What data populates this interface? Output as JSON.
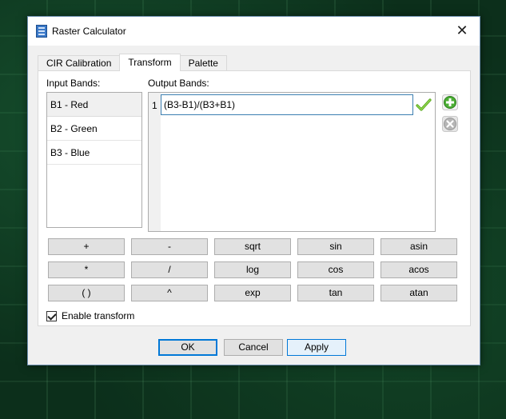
{
  "window": {
    "title": "Raster Calculator"
  },
  "tabs": [
    {
      "label": "CIR Calibration",
      "active": false
    },
    {
      "label": "Transform",
      "active": true
    },
    {
      "label": "Palette",
      "active": false
    }
  ],
  "input_bands": {
    "label": "Input Bands:",
    "items": [
      "B1 - Red",
      "B2 - Green",
      "B3 - Blue"
    ],
    "selected": "B1 - Red"
  },
  "output_bands": {
    "label": "Output Bands:",
    "rows": [
      {
        "number": "1",
        "expression": "(B3-B1)/(B3+B1)"
      }
    ]
  },
  "calc_buttons": [
    [
      "+",
      "-",
      "sqrt",
      "sin",
      "asin"
    ],
    [
      "*",
      "/",
      "log",
      "cos",
      "acos"
    ],
    [
      "( )",
      "^",
      "exp",
      "tan",
      "atan"
    ]
  ],
  "enable_transform": {
    "label": "Enable transform",
    "checked": true
  },
  "dialog_buttons": {
    "ok": "OK",
    "cancel": "Cancel",
    "apply": "Apply"
  },
  "icons": {
    "app": "raster-calculator-icon",
    "close": "close-icon",
    "valid": "checkmark-icon",
    "add": "add-icon",
    "remove": "remove-icon"
  },
  "colors": {
    "accent": "#0078d7",
    "valid_green": "#5aa81c"
  }
}
